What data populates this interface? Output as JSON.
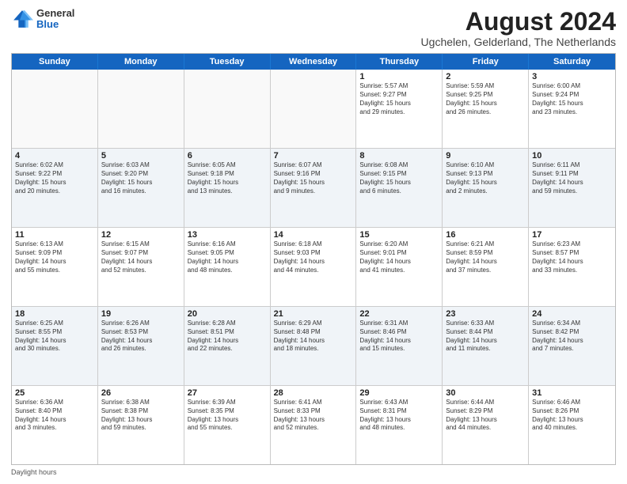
{
  "logo": {
    "general": "General",
    "blue": "Blue"
  },
  "title": "August 2024",
  "subtitle": "Ugchelen, Gelderland, The Netherlands",
  "headers": [
    "Sunday",
    "Monday",
    "Tuesday",
    "Wednesday",
    "Thursday",
    "Friday",
    "Saturday"
  ],
  "legend": "Daylight hours",
  "weeks": [
    [
      {
        "day": "",
        "info": "",
        "empty": true
      },
      {
        "day": "",
        "info": "",
        "empty": true
      },
      {
        "day": "",
        "info": "",
        "empty": true
      },
      {
        "day": "",
        "info": "",
        "empty": true
      },
      {
        "day": "1",
        "info": "Sunrise: 5:57 AM\nSunset: 9:27 PM\nDaylight: 15 hours\nand 29 minutes."
      },
      {
        "day": "2",
        "info": "Sunrise: 5:59 AM\nSunset: 9:25 PM\nDaylight: 15 hours\nand 26 minutes."
      },
      {
        "day": "3",
        "info": "Sunrise: 6:00 AM\nSunset: 9:24 PM\nDaylight: 15 hours\nand 23 minutes."
      }
    ],
    [
      {
        "day": "4",
        "info": "Sunrise: 6:02 AM\nSunset: 9:22 PM\nDaylight: 15 hours\nand 20 minutes."
      },
      {
        "day": "5",
        "info": "Sunrise: 6:03 AM\nSunset: 9:20 PM\nDaylight: 15 hours\nand 16 minutes."
      },
      {
        "day": "6",
        "info": "Sunrise: 6:05 AM\nSunset: 9:18 PM\nDaylight: 15 hours\nand 13 minutes."
      },
      {
        "day": "7",
        "info": "Sunrise: 6:07 AM\nSunset: 9:16 PM\nDaylight: 15 hours\nand 9 minutes."
      },
      {
        "day": "8",
        "info": "Sunrise: 6:08 AM\nSunset: 9:15 PM\nDaylight: 15 hours\nand 6 minutes."
      },
      {
        "day": "9",
        "info": "Sunrise: 6:10 AM\nSunset: 9:13 PM\nDaylight: 15 hours\nand 2 minutes."
      },
      {
        "day": "10",
        "info": "Sunrise: 6:11 AM\nSunset: 9:11 PM\nDaylight: 14 hours\nand 59 minutes."
      }
    ],
    [
      {
        "day": "11",
        "info": "Sunrise: 6:13 AM\nSunset: 9:09 PM\nDaylight: 14 hours\nand 55 minutes."
      },
      {
        "day": "12",
        "info": "Sunrise: 6:15 AM\nSunset: 9:07 PM\nDaylight: 14 hours\nand 52 minutes."
      },
      {
        "day": "13",
        "info": "Sunrise: 6:16 AM\nSunset: 9:05 PM\nDaylight: 14 hours\nand 48 minutes."
      },
      {
        "day": "14",
        "info": "Sunrise: 6:18 AM\nSunset: 9:03 PM\nDaylight: 14 hours\nand 44 minutes."
      },
      {
        "day": "15",
        "info": "Sunrise: 6:20 AM\nSunset: 9:01 PM\nDaylight: 14 hours\nand 41 minutes."
      },
      {
        "day": "16",
        "info": "Sunrise: 6:21 AM\nSunset: 8:59 PM\nDaylight: 14 hours\nand 37 minutes."
      },
      {
        "day": "17",
        "info": "Sunrise: 6:23 AM\nSunset: 8:57 PM\nDaylight: 14 hours\nand 33 minutes."
      }
    ],
    [
      {
        "day": "18",
        "info": "Sunrise: 6:25 AM\nSunset: 8:55 PM\nDaylight: 14 hours\nand 30 minutes."
      },
      {
        "day": "19",
        "info": "Sunrise: 6:26 AM\nSunset: 8:53 PM\nDaylight: 14 hours\nand 26 minutes."
      },
      {
        "day": "20",
        "info": "Sunrise: 6:28 AM\nSunset: 8:51 PM\nDaylight: 14 hours\nand 22 minutes."
      },
      {
        "day": "21",
        "info": "Sunrise: 6:29 AM\nSunset: 8:48 PM\nDaylight: 14 hours\nand 18 minutes."
      },
      {
        "day": "22",
        "info": "Sunrise: 6:31 AM\nSunset: 8:46 PM\nDaylight: 14 hours\nand 15 minutes."
      },
      {
        "day": "23",
        "info": "Sunrise: 6:33 AM\nSunset: 8:44 PM\nDaylight: 14 hours\nand 11 minutes."
      },
      {
        "day": "24",
        "info": "Sunrise: 6:34 AM\nSunset: 8:42 PM\nDaylight: 14 hours\nand 7 minutes."
      }
    ],
    [
      {
        "day": "25",
        "info": "Sunrise: 6:36 AM\nSunset: 8:40 PM\nDaylight: 14 hours\nand 3 minutes."
      },
      {
        "day": "26",
        "info": "Sunrise: 6:38 AM\nSunset: 8:38 PM\nDaylight: 13 hours\nand 59 minutes."
      },
      {
        "day": "27",
        "info": "Sunrise: 6:39 AM\nSunset: 8:35 PM\nDaylight: 13 hours\nand 55 minutes."
      },
      {
        "day": "28",
        "info": "Sunrise: 6:41 AM\nSunset: 8:33 PM\nDaylight: 13 hours\nand 52 minutes."
      },
      {
        "day": "29",
        "info": "Sunrise: 6:43 AM\nSunset: 8:31 PM\nDaylight: 13 hours\nand 48 minutes."
      },
      {
        "day": "30",
        "info": "Sunrise: 6:44 AM\nSunset: 8:29 PM\nDaylight: 13 hours\nand 44 minutes."
      },
      {
        "day": "31",
        "info": "Sunrise: 6:46 AM\nSunset: 8:26 PM\nDaylight: 13 hours\nand 40 minutes."
      }
    ]
  ]
}
